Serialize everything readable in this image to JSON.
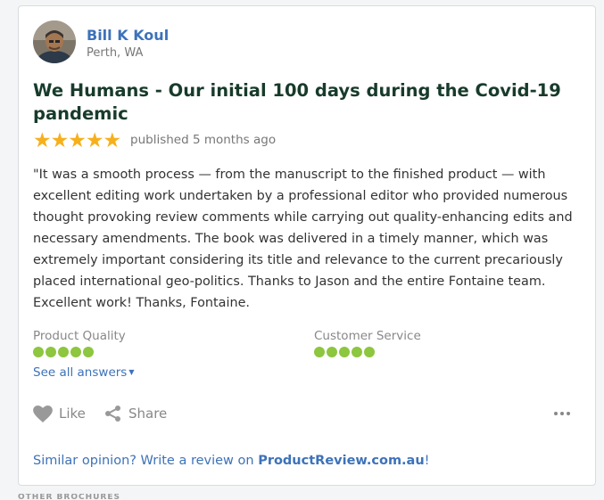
{
  "review": {
    "author": {
      "name": "Bill K Koul",
      "location": "Perth, WA"
    },
    "title": "We Humans - Our initial 100 days during the Covid-19 pandemic",
    "rating_stars": 5,
    "stars_text": "★★★★★",
    "published": "published 5 months ago",
    "body": "\"It was a smooth process — from the manuscript to the finished product — with excellent editing work undertaken by a professional editor who provided numerous thought provoking review comments while carrying out quality-enhancing edits and necessary amendments. The book was delivered in a timely manner, which was extremely important considering its title and relevance to the current precariously placed international geo-politics. Thanks to Jason and the entire Fontaine team. Excellent work! Thanks, Fontaine.",
    "ratings": [
      {
        "label": "Product Quality",
        "score": 5
      },
      {
        "label": "Customer Service",
        "score": 5
      }
    ],
    "see_all_label": "See all answers",
    "actions": {
      "like": "Like",
      "share": "Share"
    },
    "cta": {
      "prefix": "Similar opinion? Write a review on ",
      "link": "ProductReview.com.au",
      "suffix": "!"
    }
  },
  "below_heading": "OTHER BROCHURES",
  "colors": {
    "link": "#3d72b9",
    "title": "#183b2b",
    "star": "#f6b01c",
    "dot": "#8dc63f",
    "muted": "#888888"
  },
  "icons": [
    "avatar-photo",
    "heart-icon",
    "share-icon",
    "more-dots-icon",
    "caret-down-icon"
  ]
}
